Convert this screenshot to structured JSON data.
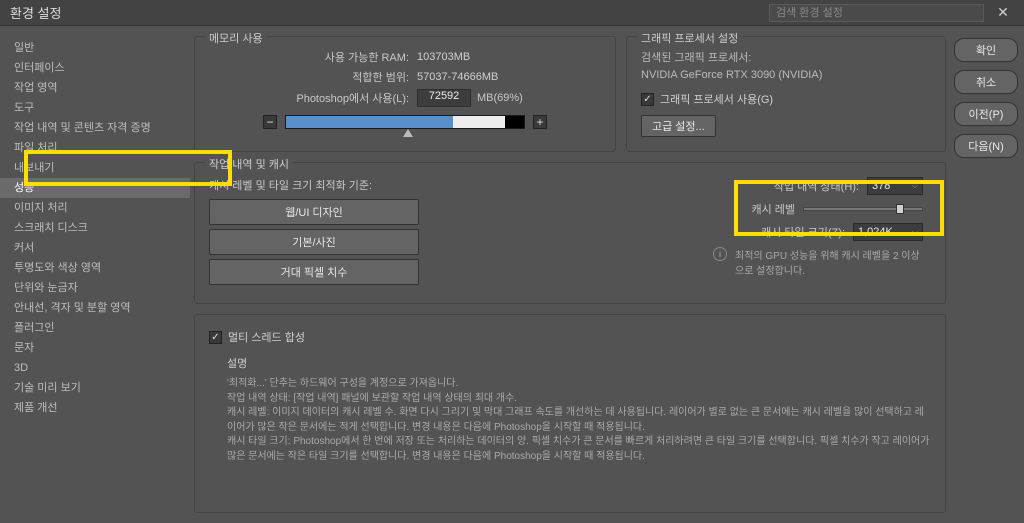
{
  "titlebar": {
    "title": "환경 설정",
    "search_placeholder": "검색 환경 설정"
  },
  "sidebar": {
    "items": [
      "일반",
      "인터페이스",
      "작업 영역",
      "도구",
      "작업 내역 및 콘텐츠 자격 증명",
      "파일 처리",
      "내보내기",
      "성능",
      "이미지 처리",
      "스크래치 디스크",
      "커서",
      "투명도와 색상 영역",
      "단위와 눈금자",
      "안내선, 격자 및 분할 영역",
      "플러그인",
      "문자",
      "3D",
      "기술 미리 보기",
      "제품 개선"
    ],
    "selected_index": 7
  },
  "buttons": {
    "ok": "확인",
    "cancel": "취소",
    "prev": "이전(P)",
    "next": "다음(N)"
  },
  "memory": {
    "group_title": "메모리 사용",
    "available_label": "사용 가능한 RAM:",
    "available_value": "103703MB",
    "ideal_label": "적합한 범위:",
    "ideal_value": "57037-74666MB",
    "ps_use_label": "Photoshop에서 사용(L):",
    "ps_use_value": "72592",
    "ps_use_suffix": "MB(69%)"
  },
  "gpu": {
    "group_title": "그래픽 프로세서 설정",
    "detected_label": "검색된 그래픽 프로세서:",
    "detected_value": "NVIDIA GeForce RTX 3090 (NVIDIA)",
    "use_label": "그래픽 프로세서 사용(G)",
    "advanced_btn": "고급 설정..."
  },
  "cache": {
    "group_title": "작업 내역 및 캐시",
    "left_label": "캐시 레벨 및 타일 크기 최적화 기준:",
    "opt1": "웹/UI 디자인",
    "opt2": "기본/사진",
    "opt3": "거대 픽셀 치수",
    "history_label": "작업 내역 상태(H):",
    "history_value": "378",
    "cache_level_label": "캐시 레벨",
    "tile_label": "캐시 타일 크기(Z):",
    "tile_value": "1,024K",
    "info_text": "최적의 GPU 성능을 위해 캐시 레벨을 2 이상으로 설정합니다."
  },
  "multi": {
    "checkbox_label": "멀티 스레드 합성",
    "desc_title": "설명",
    "desc_text": "'최적화...' 단추는 하드웨어 구성을 계정으로 가져옵니다.\n작업 내역 상태: [작업 내역] 패널에 보관할 작업 내역 상태의 최대 개수.\n캐시 레벨: 이미지 데이터의 캐시 레벨 수. 화면 다시 그리기 및 막대 그래프 속도를 개선하는 데 사용됩니다. 레이어가 별로 없는 큰 문서에는 캐시 레벨을 많이 선택하고 레이어가 많은 작은 문서에는 적게 선택합니다. 변경 내용은 다음에 Photoshop을 시작할 때 적용됩니다.\n캐시 타일 크기: Photoshop에서 한 번에 저장 또는 처리하는 데이터의 양. 픽셀 치수가 큰 문서를 빠르게 처리하려면 큰 타일 크기를 선택합니다. 픽셀 치수가 작고 레이어가 많은 문서에는 작은 타일 크기를 선택합니다. 변경 내용은 다음에 Photoshop을 시작할 때 적용됩니다."
  }
}
